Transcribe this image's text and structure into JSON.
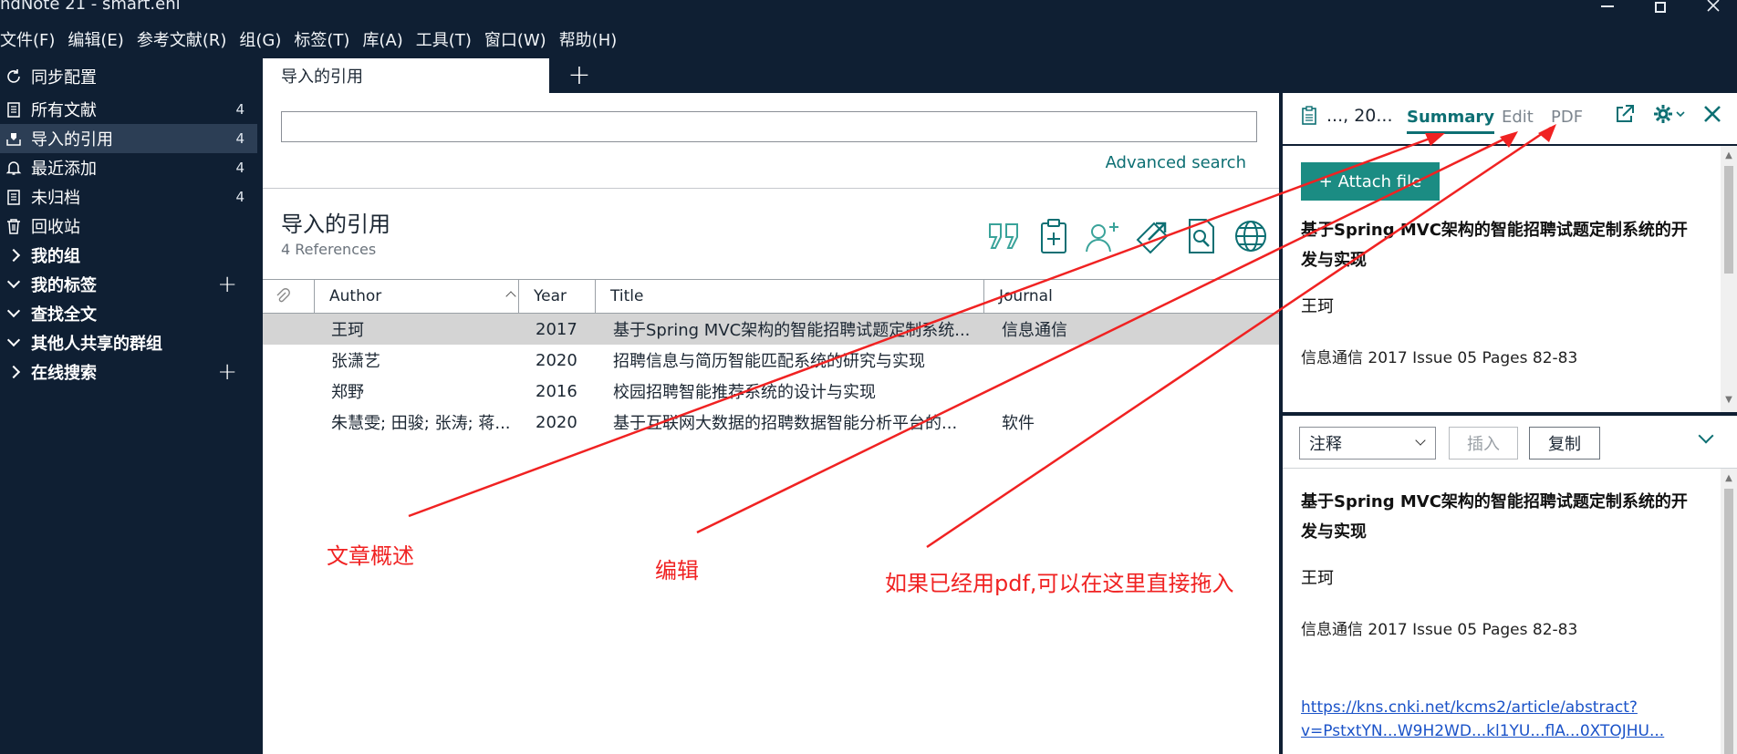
{
  "window": {
    "title": "ndNote 21 - smart.enl"
  },
  "menu": [
    "文件(F)",
    "编辑(E)",
    "参考文献(R)",
    "组(G)",
    "标签(T)",
    "库(A)",
    "工具(T)",
    "窗口(W)",
    "帮助(H)"
  ],
  "sidebar": {
    "sync": "同步配置",
    "items": [
      {
        "label": "所有文献",
        "count": "4",
        "icon": "documents-icon"
      },
      {
        "label": "导入的引用",
        "count": "4",
        "icon": "import-icon"
      },
      {
        "label": "最近添加",
        "count": "4",
        "icon": "bell-icon"
      },
      {
        "label": "未归档",
        "count": "4",
        "icon": "documents-icon"
      },
      {
        "label": "回收站",
        "icon": "trash-icon"
      }
    ],
    "groups": [
      {
        "label": "我的组",
        "expanded": false
      },
      {
        "label": "我的标签",
        "expanded": true,
        "plus": "+"
      },
      {
        "label": "查找全文",
        "expanded": true
      },
      {
        "label": "其他人共享的群组",
        "expanded": true
      },
      {
        "label": "在线搜索",
        "expanded": false,
        "plus": "+"
      }
    ]
  },
  "tabs": {
    "active": "导入的引用",
    "add": "+"
  },
  "search": {
    "value": "",
    "advanced": "Advanced search"
  },
  "library": {
    "title": "导入的引用",
    "count": "4 References"
  },
  "table": {
    "headers": {
      "author": "Author",
      "year": "Year",
      "title": "Title",
      "journal": "Journal"
    },
    "rows": [
      {
        "author": "王珂",
        "year": "2017",
        "title": "基于Spring MVC架构的智能招聘试题定制系统...",
        "journal": "信息通信",
        "selected": true
      },
      {
        "author": "张潇艺",
        "year": "2020",
        "title": "招聘信息与简历智能匹配系统的研究与实现",
        "journal": ""
      },
      {
        "author": "郑野",
        "year": "2016",
        "title": "校园招聘智能推荐系统的设计与实现",
        "journal": ""
      },
      {
        "author": "朱慧雯; 田骏; 张涛; 蒋...",
        "year": "2020",
        "title": "基于互联网大数据的招聘数据智能分析平台的...",
        "journal": "软件"
      }
    ]
  },
  "annotations": {
    "summary_note": "文章概述",
    "edit_note": "编辑",
    "pdf_note": "如果已经用pdf,可以在这里直接拖入"
  },
  "right_panel": {
    "ref_short": "..., 20...",
    "tabs": {
      "summary": "Summary",
      "edit": "Edit",
      "pdf": "PDF"
    },
    "attach": "+ Attach file",
    "summary": {
      "title": "基于Spring MVC架构的智能招聘试题定制系统的开发与实现",
      "author": "王珂",
      "source": "信息通信 2017 Issue 05 Pages 82-83"
    },
    "lower": {
      "style": "注释",
      "insert": "插入",
      "copy": "复制",
      "title": "基于Spring MVC架构的智能招聘试题定制系统的开发与实现",
      "author": "王珂",
      "source": "信息通信 2017 Issue 05 Pages 82-83",
      "url": "https://kns.cnki.net/kcms2/article/abstract?",
      "url2": "v=PstxtYN...W9H2WD...kl1YU...flA...0XTOJHU..."
    }
  },
  "colors": {
    "accent": "#0d6f73",
    "sidebar_bg": "#0f1f33",
    "annotation": "#f02222"
  }
}
